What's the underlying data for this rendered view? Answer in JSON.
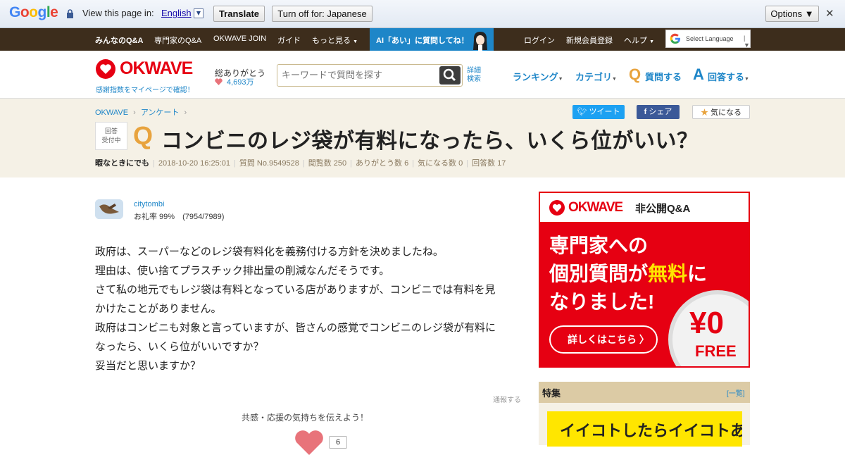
{
  "translate_bar": {
    "logo": "Google",
    "prompt": "View this page in:",
    "language": "English",
    "translate_label": "Translate",
    "turn_off_label": "Turn off for: Japanese",
    "options_label": "Options ▼",
    "close_label": "✕"
  },
  "top_nav": {
    "items": [
      "みんなのQ&A",
      "専門家のQ&A",
      "OKWAVE JOIN",
      "ガイド",
      "もっと見る"
    ],
    "ai_banner": "AI「あい」に質問してね！",
    "right_items": [
      "ログイン",
      "新規会員登録",
      "ヘルプ"
    ],
    "select_language": "Select Language"
  },
  "header": {
    "logo": "OKWAVE",
    "logo_sub": "感謝指数をマイページで確認！",
    "thanks_label": "総ありがとう",
    "thanks_count": "4,693万",
    "search_placeholder": "キーワードで質問を探す",
    "advanced_search": "詳細\n検索",
    "nav": {
      "ranking": "ランキング",
      "category": "カテゴリ",
      "ask": "質問する",
      "answer": "回答する"
    }
  },
  "question": {
    "breadcrumb": [
      "OKWAVE",
      "アンケート"
    ],
    "tweet": "ツイート",
    "share": "シェア",
    "kininaru": "気になる",
    "status": "回答\n受付中",
    "title": "コンビニのレジ袋が有料になったら、いくら位がいい？",
    "author_name": "暇なときにでも",
    "date": "2018-10-20 16:25:01",
    "question_no": "質問 No.9549528",
    "views": "閲覧数 250",
    "thanks": "ありがとう数 6",
    "watchers": "気になる数 0",
    "answers": "回答数 17",
    "user": {
      "name": "citytombi",
      "rate": "お礼率 99%　(7954/7989)"
    },
    "body": [
      "政府は、スーパーなどのレジ袋有料化を義務付ける方針を決めましたね。",
      "理由は、使い捨てプラスチック排出量の削減なんだそうです。",
      "さて私の地元でもレジ袋は有料となっている店がありますが、コンビニでは有料を見",
      "かけたことがありません。",
      "政府はコンビニも対象と言っていますが、皆さんの感覚でコンビニのレジ袋が有料に",
      "なったら、いくら位がいいですか？",
      "妥当だと思いますか？"
    ],
    "report": "通報する",
    "cheer_text": "共感・応援の気持ちを伝えよう！",
    "cheer_count": "6"
  },
  "ad": {
    "logo": "OKWAVE",
    "label": "非公開Q&A",
    "line1": "専門家への",
    "line2a": "個別質問が",
    "line2b": "無料",
    "line2c": "に",
    "line3": "なりました!",
    "yen": "¥0",
    "free": "FREE",
    "button": "詳しくはこちら"
  },
  "feature": {
    "title": "特集",
    "all_link": "[一覧]",
    "banner": "イイコトしたらイイコトある"
  }
}
